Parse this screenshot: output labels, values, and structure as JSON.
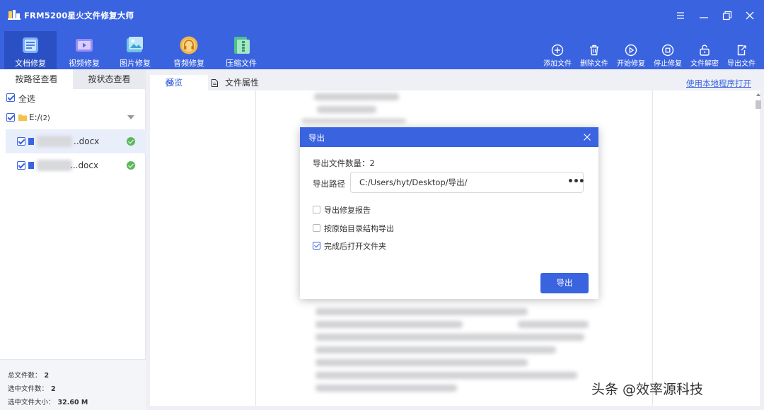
{
  "app": {
    "title": "FRM5200星火文件修复大师"
  },
  "modules": [
    {
      "label": "文档修复",
      "icon": "document-repair-icon",
      "active": true
    },
    {
      "label": "视频修复",
      "icon": "video-repair-icon",
      "active": false
    },
    {
      "label": "图片修复",
      "icon": "image-repair-icon",
      "active": false
    },
    {
      "label": "音频修复",
      "icon": "audio-repair-icon",
      "active": false
    },
    {
      "label": "压缩文件",
      "icon": "archive-file-icon",
      "active": false
    }
  ],
  "toolbar": [
    {
      "label": "添加文件",
      "icon": "add-circle-icon"
    },
    {
      "label": "删除文件",
      "icon": "trash-icon"
    },
    {
      "label": "开始修复",
      "icon": "play-icon"
    },
    {
      "label": "停止修复",
      "icon": "stop-icon"
    },
    {
      "label": "文件解密",
      "icon": "unlock-icon"
    },
    {
      "label": "导出文件",
      "icon": "export-icon"
    }
  ],
  "sidebar": {
    "tabs": [
      "按路径查看",
      "按状态查看"
    ],
    "select_all": "全选",
    "folder": {
      "name": "E:/",
      "count": "(2)"
    },
    "files": [
      {
        "ext": "..docx",
        "status": "ok"
      },
      {
        "ext": "...docx",
        "status": "ok"
      }
    ],
    "stats": [
      {
        "label": "总文件数：",
        "value": "2"
      },
      {
        "label": "选中文件数：",
        "value": "2"
      },
      {
        "label": "选中文件大小：",
        "value": "32.60 M"
      }
    ]
  },
  "main": {
    "tabs": [
      "预览",
      "文件属性"
    ],
    "open_link": "使用本地程序打开"
  },
  "dialog": {
    "title": "导出",
    "count_label": "导出文件数量：2",
    "path_label": "导出路径",
    "path_value": "C:/Users/hyt/Desktop/导出/",
    "more": "•••",
    "options": [
      {
        "label": "导出修复报告",
        "checked": false
      },
      {
        "label": "按原始目录结构导出",
        "checked": false
      },
      {
        "label": "完成后打开文件夹",
        "checked": true
      }
    ],
    "button": "导出"
  },
  "watermark": "头条 @效率源科技",
  "colors": {
    "primary": "#3a63e0",
    "active_module": "#2b50c4",
    "success": "#5cb85c"
  }
}
